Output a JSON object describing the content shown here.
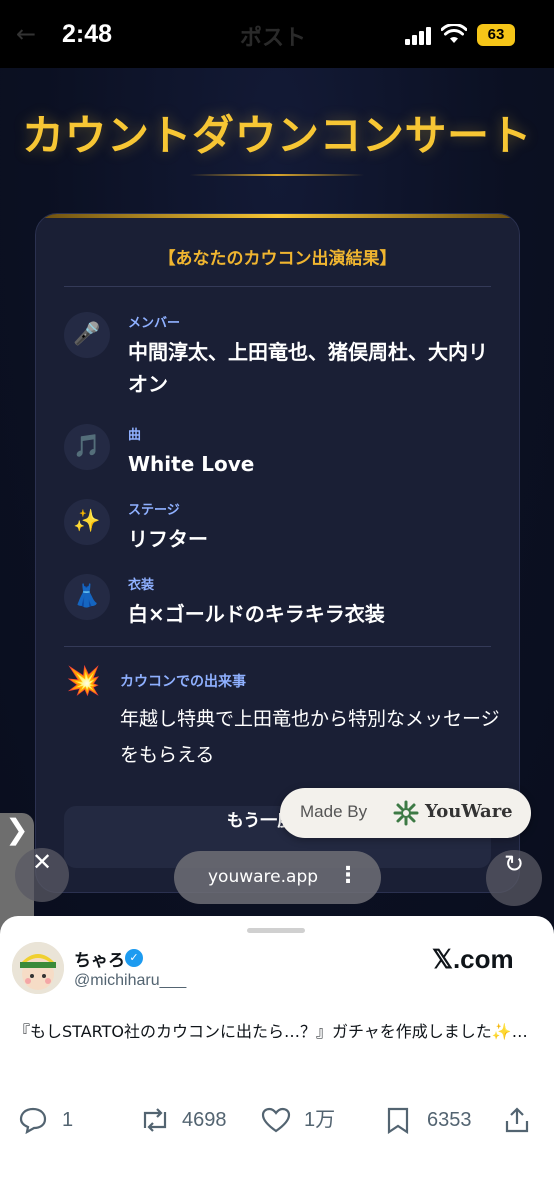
{
  "status": {
    "time": "2:48",
    "back_glyph": "←",
    "center_text": "ポスト",
    "battery": "63"
  },
  "app": {
    "title": "カウントダウンコンサート",
    "card": {
      "header": "【あなたのカウコン出演結果】",
      "rows": [
        {
          "icon": "microphone-icon",
          "emoji": "🎤",
          "label": "メンバー",
          "value": "中間淳太、上田竜也、猪俣周杜、大内リオン"
        },
        {
          "icon": "music-notes-icon",
          "emoji": "🎵",
          "label": "曲",
          "value": "White Love"
        },
        {
          "icon": "sparkles-icon",
          "emoji": "✨",
          "label": "ステージ",
          "value": "リフター"
        },
        {
          "icon": "dress-icon",
          "emoji": "👗",
          "label": "衣装",
          "value": "白×ゴールドのキラキラ衣装"
        }
      ],
      "event": {
        "icon": "explosion-icon",
        "emoji": "💥",
        "label": "カウコンでの出来事",
        "text": "年越し特典で上田竜也から特別なメッセージをもらえる"
      },
      "retry_label": "もう一度回す"
    },
    "made_by": {
      "prefix": "Made By",
      "brand": "YouWare"
    }
  },
  "browser": {
    "side_tab_glyph": "❯",
    "close_glyph": "✕",
    "url": "youware.app",
    "more_glyph": "⋮",
    "reload_glyph": "↻"
  },
  "sheet": {
    "user_name": "ちゃろ",
    "verified_glyph": "✓",
    "handle": "@michiharu___",
    "source": "𝕏.com",
    "tweet_text": "『もしSTARTO社のカウコンに出たら…？』ガチャを作成しました✨…",
    "actions": {
      "replies": "1",
      "reposts": "4698",
      "likes": "1万",
      "bookmarks": "6353"
    }
  },
  "colors": {
    "accent_gold": "#f7c634",
    "label_blue": "#8fb0ff",
    "card_bg": "#1a1f35",
    "verified_blue": "#1d9bf0"
  }
}
